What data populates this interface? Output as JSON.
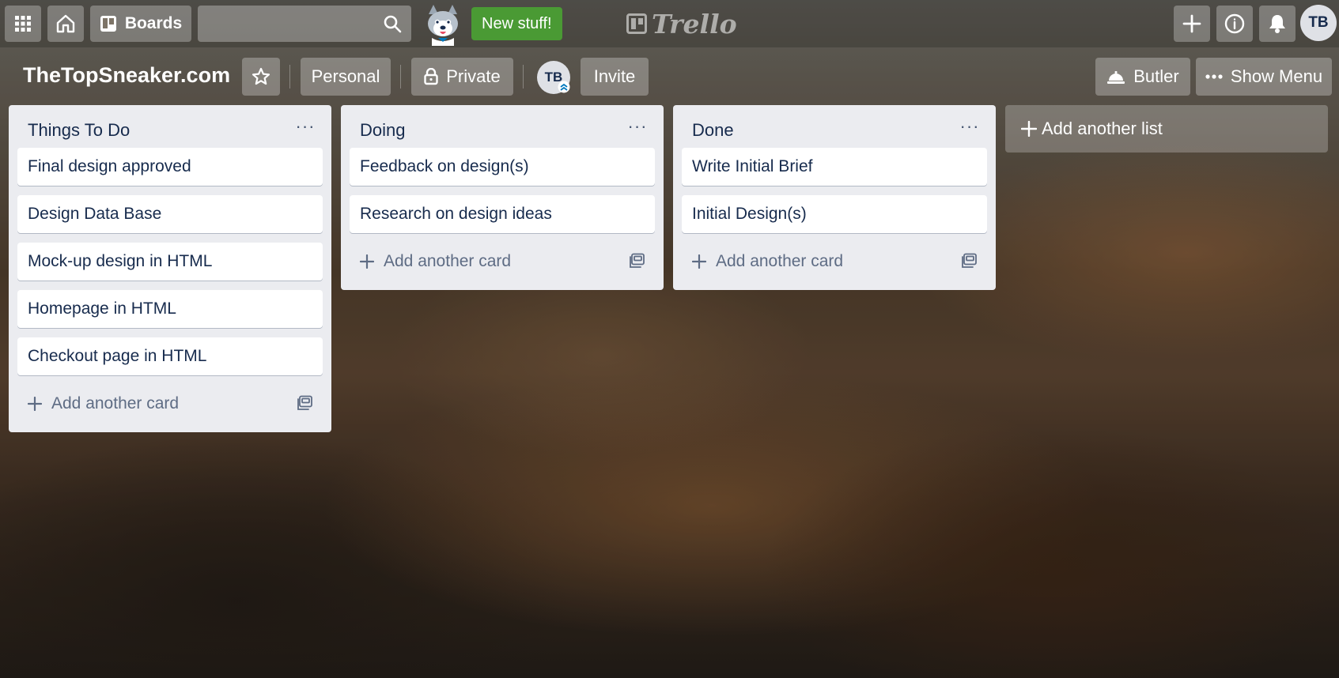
{
  "topbar": {
    "boards_label": "Boards",
    "new_stuff_label": "New stuff!",
    "logo_text": "Trello",
    "avatar_initials": "TB"
  },
  "board": {
    "title": "TheTopSneaker.com",
    "workspace_label": "Personal",
    "visibility_label": "Private",
    "member_initials": "TB",
    "invite_label": "Invite",
    "butler_label": "Butler",
    "show_menu_label": "Show Menu"
  },
  "lists": [
    {
      "title": "Things To Do",
      "cards": [
        "Final design approved",
        "Design Data Base",
        "Mock-up design in HTML",
        "Homepage in HTML",
        "Checkout page in HTML"
      ],
      "add_card_label": "Add another card"
    },
    {
      "title": "Doing",
      "cards": [
        "Feedback on design(s)",
        "Research on design ideas"
      ],
      "add_card_label": "Add another card"
    },
    {
      "title": "Done",
      "cards": [
        "Write Initial Brief",
        "Initial Design(s)"
      ],
      "add_card_label": "Add another card"
    }
  ],
  "list_menu_glyph": "···",
  "add_list_label": "Add another list"
}
